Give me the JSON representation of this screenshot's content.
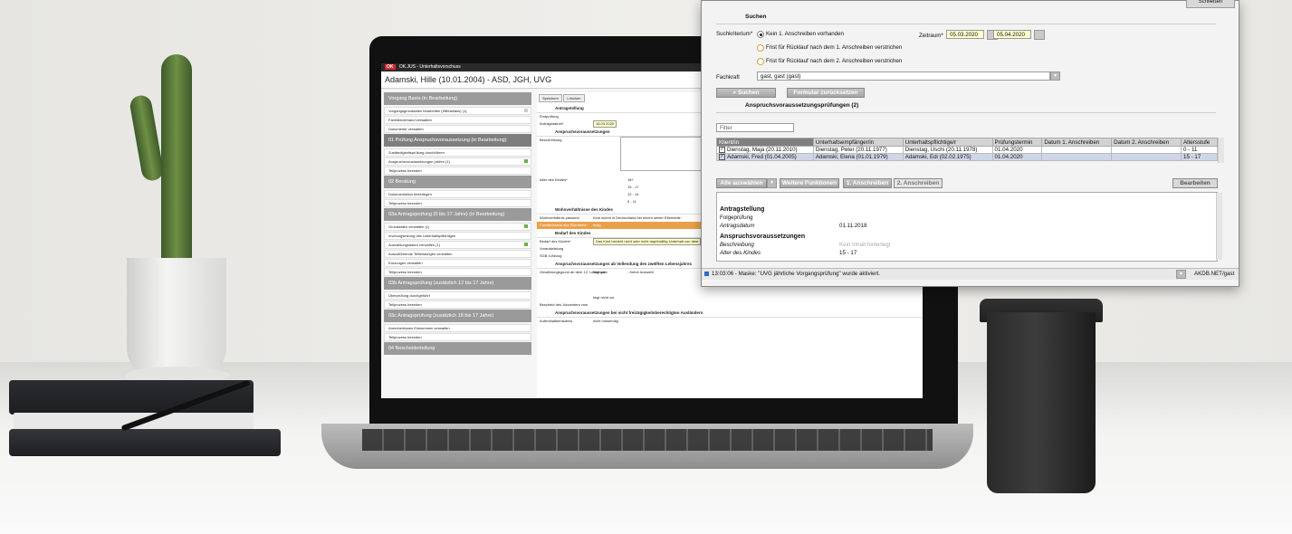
{
  "laptop_app": {
    "window_title": "OK.JUS - Unterhaltsvorschuss",
    "logo_text": "OK",
    "case_title": "Adamski, Hille (10.01.2004) - ASD, JGH, UVG",
    "left_panel": [
      {
        "head": "Vorgang Basis (in Bearbeitung)",
        "items": [
          "Vorgangsgrunddaten bearbeiten (Hilfeanlass) (1)",
          "Familienverband verwalten",
          "Dokumente verwalten"
        ]
      },
      {
        "head": "01 Prüfung Anspruchsvoraussetzung (in Bearbeitung)",
        "items": [
          "Zuständigkeitsprüfung durchführen",
          "Anspruchsvoraussetzungen prüfen (1)",
          "Teilprozess beenden"
        ]
      },
      {
        "head": "02 Beratung",
        "items": [
          "Dokumentation hinterlegen",
          "Teilprozess beenden"
        ]
      },
      {
        "head": "03a Antragsprüfung (0 bis 17 Jahre) (in Bearbeitung)",
        "items": [
          "Grunddaten verwalten (1)",
          "Inverzugsetzung des Unterhaltspflichtigen",
          "Auszahlungsdaten verwalten (1)",
          "Auszuführende Teilleistungen verwalten",
          "Kürzungen verwalten",
          "Teilprozess beenden"
        ]
      },
      {
        "head": "03b Antragsprüfung (zusätzlich 12 bis 17 Jahre)",
        "items": [
          "Überprüfung durchgeführt",
          "Teilprozess beenden"
        ]
      },
      {
        "head": "03c Antragsprüfung (zusätzlich 18 bis 17 Jahre)",
        "items": [
          "Anrechenbares Einkommen verwalten",
          "Teilprozess beenden"
        ]
      },
      {
        "head": "04 Bescheiderteilung",
        "items": []
      }
    ],
    "toolbar": {
      "save": "Speichern",
      "delete": "Löschen"
    },
    "form": {
      "sec_antrag": "Antragstellung",
      "erstpruefung": "Erstprüfung",
      "antragsdatum_label": "Antragsdatum*",
      "antragsdatum": "18.03.2020",
      "sec_anspruch": "Anspruchsvoraussetzungen",
      "beschreibung": "Beschreibung",
      "alter_label": "Alter des Kindes*",
      "alter_options": [
        "18+",
        "15 - 17",
        "12 - 14",
        "0 - 11"
      ],
      "sec_wohn": "Wohnverhältnisse des Kindes",
      "wohn_label": "Wohnverhältnis passend",
      "wohn_val": "Kind wohnt in Deutschland bei einem seiner Elternteile",
      "famstand_label": "Familienstand des Elternteils*",
      "famstand_val": "ledig",
      "sec_bedarf": "Bedarf des Kindes",
      "bedarf_label": "Bedarf des Kindes*",
      "bedarf_val": "Das Kind bezieht nicht oder nicht regelmäßig Unterhalt von dem",
      "vorausleistung": "Vorausleistung",
      "sgb": "SGB II-Bezug",
      "sec_zwoelf": "Anspruchsvoraussetzungen ab Vollendung des zwölften Lebensjahres",
      "gewaehrung": "Gewährungsgrund ab dem 12. Lebensjahr",
      "liegt_vor": "liegt vor",
      "keine_auswahl": "- Keine Auswahl",
      "liegt_nicht_vor": "liegt nicht vor",
      "bescheid": "Bescheid des Jobcenters vom",
      "sec_auslaender": "Anspruchsvoraussetzungen bei nicht freizügigkeitsberechtigten Ausländern",
      "aufenthalt": "Aufenthaltserlaubnis",
      "nicht_notwendig": "nicht notwendig"
    }
  },
  "dialog": {
    "top_button": "Schließen",
    "search_legend": "Suchen",
    "criterion_label": "Suchkriterium*",
    "criteria": [
      "Kein 1. Anschreiben vorhanden",
      "Frist für Rücklauf nach dem 1. Anschreiben verstrichen",
      "Frist für Rücklauf nach dem 2. Anschreiben verstrichen"
    ],
    "period_label": "Zeitraum*",
    "period_from": "05.03.2020",
    "period_sep": "-",
    "period_to": "05.04.2020",
    "fachkraft_label": "Fachkraft",
    "fachkraft_value": "gast, gast (gast)",
    "search_button": "Suchen",
    "reset_button": "Formular zurücksetzen",
    "results_legend": "Anspruchsvoraussetzungsprüfungen (2)",
    "filter_placeholder": "Filter",
    "columns": [
      "Klient/in",
      "Unterhaltsempfänger/in",
      "Unterhaltspflichtige/r",
      "Prüfungstermin",
      "Datum 1. Anschreiben",
      "Datum 2. Anschreiben",
      "Altersstufe"
    ],
    "rows": [
      [
        "Dienstag, Maja (20.11.2010)",
        "Dienstag, Peter (20.11.1977)",
        "Dienstag, Uschi (20.11.1978)",
        "01.04.2020",
        "",
        "",
        "0 - 11"
      ],
      [
        "Adamski, Fred (01.04.2005)",
        "Adamski, Elena (01.01.1979)",
        "Adamski, Edi (02.02.1975)",
        "01.04.2020",
        "",
        "",
        "15 - 17"
      ]
    ],
    "btn_select_all": "Alle auswählen",
    "btn_more": "Weitere Funktionen",
    "btn_letter1": "1. Anschreiben",
    "btn_letter2": "2. Anschreiben",
    "btn_edit": "Bearbeiten",
    "details": [
      {
        "label": "Antragstellung",
        "style": "bold",
        "value": ""
      },
      {
        "label": "Folgeprüfung",
        "style": "normal",
        "value": ""
      },
      {
        "label": "Antragsdatum",
        "style": "italic",
        "value": "01.11.2018"
      },
      {
        "label": "Anspruchsvoraussetzungen",
        "style": "bold",
        "value": ""
      },
      {
        "label": "Beschreibung",
        "style": "italic",
        "value": "Kein Inhalt hinterlegt"
      },
      {
        "label": "Alter des Kindes",
        "style": "italic",
        "value": "15 - 17"
      }
    ],
    "status_text": "13:03:06 - Maske: \"UVG jährliche Vorgangsprüfung\" wurde aktiviert.",
    "status_user": "AKDB.NET/gast"
  }
}
